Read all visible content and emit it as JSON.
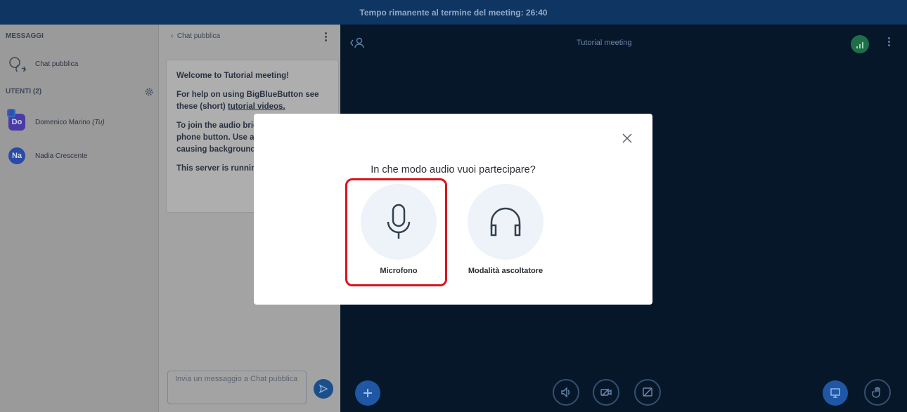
{
  "topbar": {
    "timer_text": "Tempo rimanente al termine del meeting: 26:40"
  },
  "userlist": {
    "messages_title": "MESSAGGI",
    "public_chat_label": "Chat pubblica",
    "users_title": "UTENTI (2)",
    "users": [
      {
        "initials": "Do",
        "name": "Domenico Marino",
        "suffix": "(Tu)",
        "color": "#4a3aa8"
      },
      {
        "initials": "Na",
        "name": "Nadia Crescente",
        "suffix": "",
        "color": "#2a4aa8"
      }
    ]
  },
  "chat": {
    "header_label": "Chat pubblica",
    "welcome_title": "Welcome to Tutorial meeting!",
    "help_text_1": "For help on using BigBlueButton see these (short)",
    "help_link": "tutorial videos.",
    "audio_text": "To join the audio bridge click the phone button. Use a headset to avoid causing background noise for others.",
    "server_text": "This server is running BigBlueButton.",
    "input_placeholder": "Invia un messaggio a Chat pubblica"
  },
  "main": {
    "meeting_title": "Tutorial meeting"
  },
  "modal": {
    "question": "In che modo audio vuoi partecipare?",
    "option_microphone": "Microfono",
    "option_listen": "Modalità ascoltatore"
  },
  "colors": {
    "accent": "#0f3563",
    "highlight": "#d7141e",
    "background": "#06172a"
  }
}
